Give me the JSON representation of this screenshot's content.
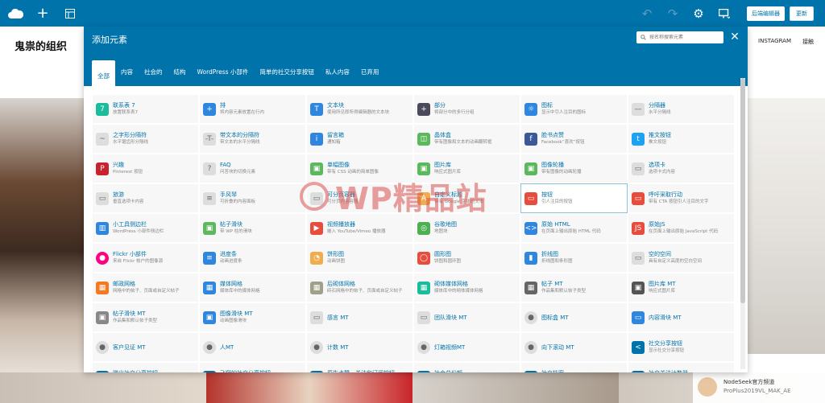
{
  "toolbar": {
    "backend_label": "后端编辑器",
    "update_label": "更新"
  },
  "site": {
    "title": "鬼祟的组织",
    "nav": [
      "INSTAGRAM",
      "接触"
    ]
  },
  "notice": {
    "line1": "NodeSeek官方频道",
    "line2": "ProPlus2019VL_MAK_AE"
  },
  "watermark": {
    "text": "WP精品站"
  },
  "modal": {
    "title": "添加元素",
    "search_placeholder": "按名称搜索元素",
    "tabs": [
      "全部",
      "内容",
      "社会的",
      "结构",
      "WordPress 小部件",
      "简单的社交分享按钮",
      "私人内容",
      "已弃用"
    ],
    "active_tab": "全部",
    "elements": [
      {
        "label": "联系表 7",
        "desc": "放置联系表7",
        "color": "#1abc9c",
        "icon": "7"
      },
      {
        "label": "排",
        "desc": "将内容元素放置在行内",
        "color": "#2e86de",
        "icon": "+"
      },
      {
        "label": "文本块",
        "desc": "使用所见即所得编辑器的文本块",
        "color": "#2e86de",
        "icon": "T"
      },
      {
        "label": "部分",
        "desc": "将部分中的多行分组",
        "color": "#4a4a5a",
        "icon": "+"
      },
      {
        "label": "图标",
        "desc": "显示中引人注目的图标",
        "color": "#2e86de",
        "icon": "☼"
      },
      {
        "label": "分隔器",
        "desc": "水平分隔线",
        "color": "#dddddd",
        "icon": "—"
      },
      {
        "label": "之字形分隔符",
        "desc": "水平锯齿形分隔线",
        "color": "#dddddd",
        "icon": "~"
      },
      {
        "label": "带文本的分隔符",
        "desc": "带文本的水平分隔线",
        "color": "#dddddd",
        "icon": "-T-"
      },
      {
        "label": "留言箱",
        "desc": "通知箱",
        "color": "#2e86de",
        "icon": "i"
      },
      {
        "label": "晶体盒",
        "desc": "带有图像和文本的动画翻转框",
        "color": "#5cb85c",
        "icon": "◫"
      },
      {
        "label": "脸书点赞",
        "desc": "Facebook“喜欢”按钮",
        "color": "#3b5998",
        "icon": "f"
      },
      {
        "label": "推文按钮",
        "desc": "推文按钮",
        "color": "#1da1f2",
        "icon": "t"
      },
      {
        "label": "兴趣",
        "desc": "Pinterest 按钮",
        "color": "#c8232c",
        "icon": "P"
      },
      {
        "label": "FAQ",
        "desc": "问答块的切换元素",
        "color": "#dddddd",
        "icon": "?"
      },
      {
        "label": "单幅图像",
        "desc": "带有 CSS 动画的简单图像",
        "color": "#5cb85c",
        "icon": "▣"
      },
      {
        "label": "图片库",
        "desc": "响应式图片库",
        "color": "#5cb85c",
        "icon": "▣"
      },
      {
        "label": "图像轮播",
        "desc": "带有图像的动画轮播",
        "color": "#5cb85c",
        "icon": "▣"
      },
      {
        "label": "选项卡",
        "desc": "选项卡式内容",
        "color": "#dddddd",
        "icon": "▭"
      },
      {
        "label": "旅游",
        "desc": "垂直选项卡内容",
        "color": "#dddddd",
        "icon": "▭"
      },
      {
        "label": "手风琴",
        "desc": "可折叠的内容面板",
        "color": "#dddddd",
        "icon": "≡"
      },
      {
        "label": "可分页容器",
        "desc": "可分页内容容器",
        "color": "#dddddd",
        "icon": "▭"
      },
      {
        "label": "自定义标题",
        "desc": "带有 Google 字体的文本",
        "color": "#f0ad4e",
        "icon": "A"
      },
      {
        "label": "按钮",
        "desc": "引人注目的按钮",
        "color": "#e74c3c",
        "icon": "▭"
      },
      {
        "label": "呼吁采取行动",
        "desc": "带有 CTA 按钮引人注目的文字",
        "color": "#e74c3c",
        "icon": "▭"
      },
      {
        "label": "小工具侧边栏",
        "desc": "WordPress 小部件侧边栏",
        "color": "#2e86de",
        "icon": "▥"
      },
      {
        "label": "帖子滑块",
        "desc": "带 WP 柱的滑块",
        "color": "#5cb85c",
        "icon": "▣"
      },
      {
        "label": "视频播放器",
        "desc": "嵌入 YouTube/Vimeo 播放器",
        "color": "#e74c3c",
        "icon": "▶"
      },
      {
        "label": "谷歌地图",
        "desc": "地图块",
        "color": "#4caf50",
        "icon": "◎"
      },
      {
        "label": "原始 HTML",
        "desc": "在页面上输出原始 HTML 代码",
        "color": "#2e86de",
        "icon": "<>"
      },
      {
        "label": "原始JS",
        "desc": "在页面上输出原始 JavaScript 代码",
        "color": "#e74c3c",
        "icon": "JS"
      },
      {
        "label": "Flickr 小部件",
        "desc": "来自 Flickr 帐户的图像源",
        "color": "#ff0084",
        "icon": "●"
      },
      {
        "label": "进度条",
        "desc": "动画进度条",
        "color": "#2e86de",
        "icon": "≡"
      },
      {
        "label": "饼形图",
        "desc": "动画饼图",
        "color": "#f0ad4e",
        "icon": "◔"
      },
      {
        "label": "圆形图",
        "desc": "饼图和圆环图",
        "color": "#e74c3c",
        "icon": "◯"
      },
      {
        "label": "折线图",
        "desc": "折线图和条形图",
        "color": "#2e86de",
        "icon": "▮"
      },
      {
        "label": "空的空间",
        "desc": "具有自定义高度的空白空间",
        "color": "#dddddd",
        "icon": "▭"
      },
      {
        "label": "邮政网格",
        "desc": "网格中的帖子、页面或自定义帖子",
        "color": "#f47920",
        "icon": "▦"
      },
      {
        "label": "媒体网格",
        "desc": "媒体库中的媒体网格",
        "color": "#2e86de",
        "icon": "▦"
      },
      {
        "label": "后砌体网格",
        "desc": "砖石网格中的帖子、页面或自定义帖子",
        "color": "#a0a08a",
        "icon": "▦"
      },
      {
        "label": "砌体媒体网格",
        "desc": "媒体库中的砌体媒体网格",
        "color": "#1abc9c",
        "icon": "▦"
      },
      {
        "label": "帖子 MT",
        "desc": "作品集和默认帖子类型",
        "color": "#666666",
        "icon": "▦"
      },
      {
        "label": "图片库 MT",
        "desc": "响应式图片库",
        "color": "#555555",
        "icon": "▣"
      },
      {
        "label": "帖子滑块 MT",
        "desc": "作品集和默认帖子类型",
        "color": "#888888",
        "icon": "▣"
      },
      {
        "label": "图像滑块 MT",
        "desc": "动画图像滑块",
        "color": "#2e86de",
        "icon": "▣"
      },
      {
        "label": "感言 MT",
        "desc": "",
        "color": "#dddddd",
        "icon": "▭"
      },
      {
        "label": "团队滑块 MT",
        "desc": "",
        "color": "#dddddd",
        "icon": "▭"
      },
      {
        "label": "图标盒 MT",
        "desc": "",
        "color": "#dddddd",
        "icon": "●"
      },
      {
        "label": "内容滑块 MT",
        "desc": "",
        "color": "#2e86de",
        "icon": "▭"
      },
      {
        "label": "客户见证 MT",
        "desc": "",
        "color": "#dddddd",
        "icon": "●"
      },
      {
        "label": "人MT",
        "desc": "",
        "color": "#dddddd",
        "icon": "●"
      },
      {
        "label": "计数 MT",
        "desc": "",
        "color": "#dddddd",
        "icon": "●"
      },
      {
        "label": "灯箱视频MT",
        "desc": "",
        "color": "#dddddd",
        "icon": "●"
      },
      {
        "label": "向下滚动 MT",
        "desc": "",
        "color": "#dddddd",
        "icon": "●"
      },
      {
        "label": "社交分享按钮",
        "desc": "显示社交分享按钮",
        "color": "#0073aa",
        "icon": "<"
      },
      {
        "label": "微出社交分享按钮",
        "desc": "显示微出社交分享按钮",
        "color": "#0073aa",
        "icon": "<"
      },
      {
        "label": "飞翔的社交分享按钮",
        "desc": "显示飞翔的社交分享按钮",
        "color": "#0073aa",
        "icon": "<"
      },
      {
        "label": "原生点赞、关注和订阅按钮",
        "desc": "显示原生点赞、关注和订阅按钮",
        "color": "#0073aa",
        "icon": "<"
      },
      {
        "label": "社会总份额",
        "desc": "显示社会总份额",
        "color": "#0073aa",
        "icon": "<"
      },
      {
        "label": "社交档案",
        "desc": "显示社交档案",
        "color": "#0073aa",
        "icon": "<"
      },
      {
        "label": "社交关注计数器",
        "desc": "显示社交关注计数器",
        "color": "#0073aa",
        "icon": "<"
      }
    ]
  }
}
